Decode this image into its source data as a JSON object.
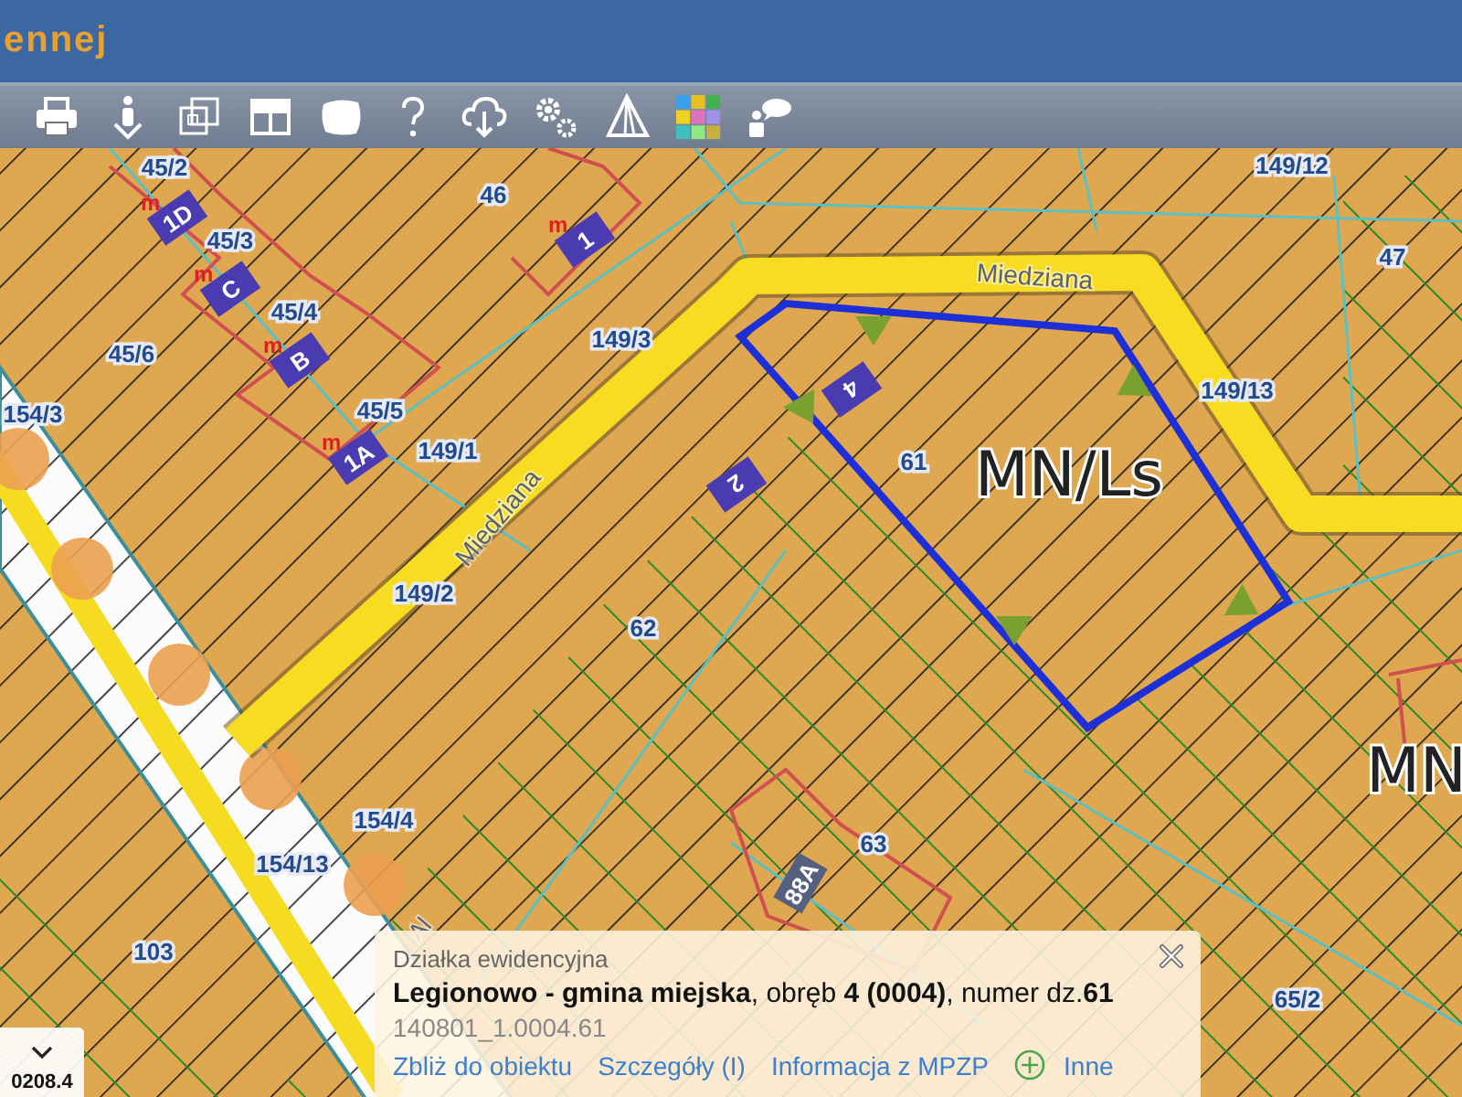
{
  "header": {
    "title": "ennej"
  },
  "map": {
    "parcels": [
      "45/2",
      "46",
      "45/3",
      "45/4",
      "45/6",
      "45/5",
      "149/3",
      "154/3",
      "149/1",
      "149/2",
      "62",
      "149/13",
      "47",
      "149/12",
      "61",
      "154/4",
      "154/13",
      "103",
      "63",
      "65/2"
    ],
    "buildings": [
      {
        "label": "1D",
        "marker": "m"
      },
      {
        "label": "C",
        "marker": "m"
      },
      {
        "label": "B",
        "marker": "m"
      },
      {
        "label": "1A",
        "marker": "m"
      },
      {
        "label": "1",
        "marker": "m"
      },
      {
        "label": "4"
      },
      {
        "label": "2"
      },
      {
        "label": "88A"
      }
    ],
    "streets": [
      "Miedziana",
      "Miedziana",
      "Al"
    ],
    "zones": [
      "MN/Ls",
      "MN"
    ]
  },
  "popup": {
    "heading": "Działka ewidencyjna",
    "description": "**Legionowo - gmina miejska**, obręb **4 (0004)**, numer dz.**61**",
    "identifier": "140801_1.0004.61",
    "links": [
      {
        "label": "Zbliż do obiektu",
        "kind": "link"
      },
      {
        "label": "Szczegóły (I)",
        "kind": "link"
      },
      {
        "label": "Informacja z MPZP",
        "kind": "link"
      },
      {
        "label": "Inne",
        "kind": "more"
      }
    ]
  },
  "scale": {
    "value": "0208.4"
  }
}
